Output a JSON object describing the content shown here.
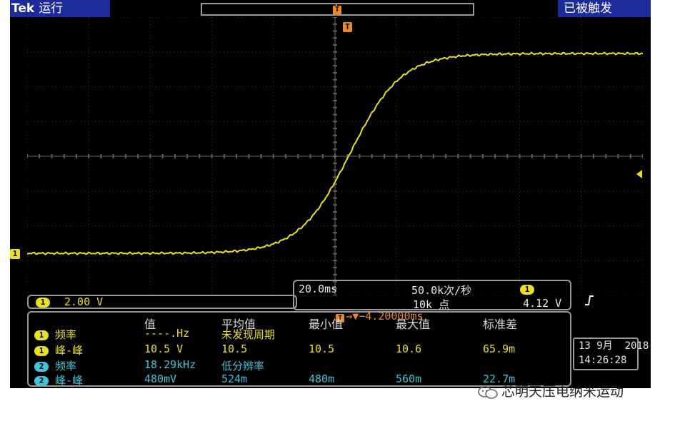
{
  "top_bar": {
    "brand": "Tek",
    "run_state": "运行",
    "trigger_status": "已被触发",
    "trigger_icon": "T"
  },
  "markers": {
    "ch1_label": "1",
    "trigger_position_label": "T"
  },
  "channel_scale": {
    "channel": "1",
    "volts_per_div": "2.00 V"
  },
  "acquisition": {
    "time_per_div": "20.0ms",
    "sample_rate": "50.0k次/秒",
    "trigger_delay_icon": "T",
    "trigger_delay": "→▼−4.20000ms",
    "record_length": "10k 点",
    "trigger_channel": "1",
    "trigger_slope_icon": "rising-edge-icon",
    "trigger_level": "4.12 V"
  },
  "measurements": {
    "headers": [
      "值",
      "平均值",
      "最小值",
      "最大值",
      "标准差"
    ],
    "rows": [
      {
        "channel": "1",
        "name": "频率",
        "value": "----.Hz",
        "mean": "未发现周期",
        "min": "",
        "max": "",
        "std": ""
      },
      {
        "channel": "1",
        "name": "峰-峰",
        "value": "10.5 V",
        "mean": "10.5",
        "min": "10.5",
        "max": "10.6",
        "std": "65.9m"
      },
      {
        "channel": "2",
        "name": "频率",
        "value": "18.29kHz",
        "mean": "低分辨率",
        "min": "",
        "max": "",
        "std": ""
      },
      {
        "channel": "2",
        "name": "峰-峰",
        "value": "480mV",
        "mean": "524m",
        "min": "480m",
        "max": "560m",
        "std": "22.7m"
      }
    ]
  },
  "datetime": {
    "date": "13 9月  2018",
    "time": "14:26:28"
  },
  "watermark": {
    "text": "芯明天压电纳米运动"
  },
  "colors": {
    "ch1": "#e8e020",
    "ch2": "#3fc5d8",
    "trigger": "#e88a2a",
    "bar": "#1c2a9a",
    "border": "#9a9a9a"
  },
  "waveform": {
    "channel": "1",
    "shape": "sigmoid rising edge"
  }
}
